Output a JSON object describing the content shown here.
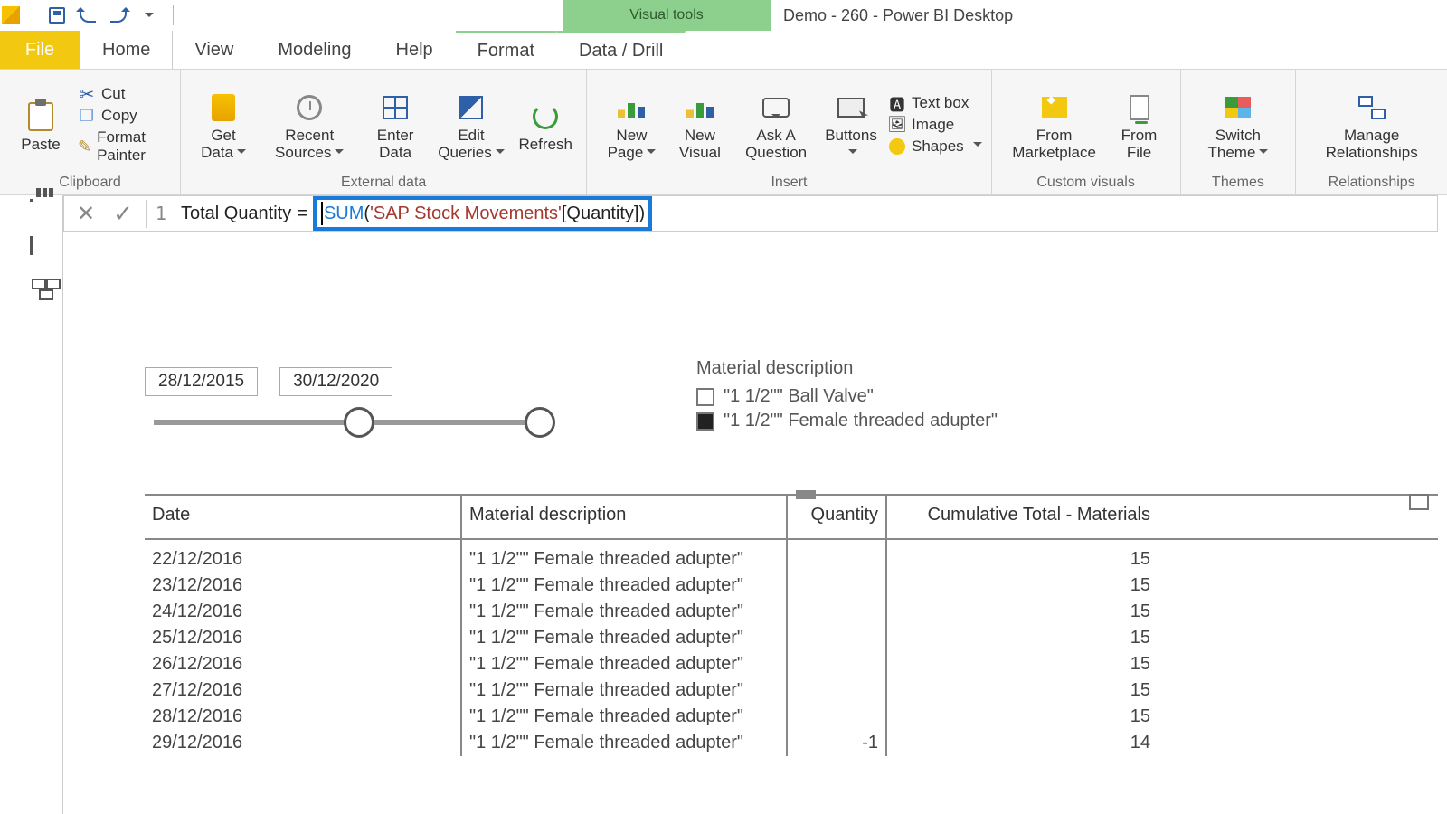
{
  "window": {
    "title": "Demo - 260 - Power BI Desktop",
    "contextual_tab": "Visual tools"
  },
  "qat": {
    "save": "Save",
    "undo": "Undo",
    "redo": "Redo"
  },
  "tabs": {
    "file": "File",
    "home": "Home",
    "view": "View",
    "modeling": "Modeling",
    "help": "Help",
    "format": "Format",
    "data_drill": "Data / Drill"
  },
  "ribbon": {
    "clipboard": {
      "title": "Clipboard",
      "paste": "Paste",
      "cut": "Cut",
      "copy": "Copy",
      "format_painter": "Format Painter"
    },
    "external_data": {
      "title": "External data",
      "get_data": "Get Data",
      "recent_sources": "Recent Sources",
      "enter_data": "Enter Data",
      "edit_queries": "Edit Queries",
      "refresh": "Refresh"
    },
    "insert": {
      "title": "Insert",
      "new_page": "New Page",
      "new_visual": "New Visual",
      "ask_question": "Ask A Question",
      "buttons": "Buttons",
      "text_box": "Text box",
      "image": "Image",
      "shapes": "Shapes"
    },
    "custom_visuals": {
      "title": "Custom visuals",
      "from_marketplace": "From Marketplace",
      "from_file": "From File"
    },
    "themes": {
      "title": "Themes",
      "switch_theme": "Switch Theme"
    },
    "relationships": {
      "title": "Relationships",
      "manage": "Manage Relationships"
    }
  },
  "formula": {
    "line_number": "1",
    "measure_name": "Total Quantity",
    "equals": "=",
    "function": "SUM",
    "open_paren": "(",
    "table_ref": "'SAP Stock Movements'",
    "column_ref": "[Quantity]",
    "close_paren": ")"
  },
  "slicer": {
    "start_date": "28/12/2015",
    "end_date": "30/12/2020"
  },
  "legend": {
    "title": "Material description",
    "items": [
      {
        "label": "\"1 1/2\"\" Ball Valve\"",
        "checked": false
      },
      {
        "label": "\"1 1/2\"\" Female threaded adupter\"",
        "checked": true
      }
    ]
  },
  "table": {
    "headers": {
      "date": "Date",
      "material": "Material description",
      "quantity": "Quantity",
      "cumulative": "Cumulative Total - Materials"
    },
    "rows": [
      {
        "date": "22/12/2016",
        "material": "\"1 1/2\"\" Female threaded adupter\"",
        "quantity": "",
        "cumulative": "15"
      },
      {
        "date": "23/12/2016",
        "material": "\"1 1/2\"\" Female threaded adupter\"",
        "quantity": "",
        "cumulative": "15"
      },
      {
        "date": "24/12/2016",
        "material": "\"1 1/2\"\" Female threaded adupter\"",
        "quantity": "",
        "cumulative": "15"
      },
      {
        "date": "25/12/2016",
        "material": "\"1 1/2\"\" Female threaded adupter\"",
        "quantity": "",
        "cumulative": "15"
      },
      {
        "date": "26/12/2016",
        "material": "\"1 1/2\"\" Female threaded adupter\"",
        "quantity": "",
        "cumulative": "15"
      },
      {
        "date": "27/12/2016",
        "material": "\"1 1/2\"\" Female threaded adupter\"",
        "quantity": "",
        "cumulative": "15"
      },
      {
        "date": "28/12/2016",
        "material": "\"1 1/2\"\" Female threaded adupter\"",
        "quantity": "",
        "cumulative": "15"
      },
      {
        "date": "29/12/2016",
        "material": "\"1 1/2\"\" Female threaded adupter\"",
        "quantity": "-1",
        "cumulative": "14"
      }
    ]
  }
}
